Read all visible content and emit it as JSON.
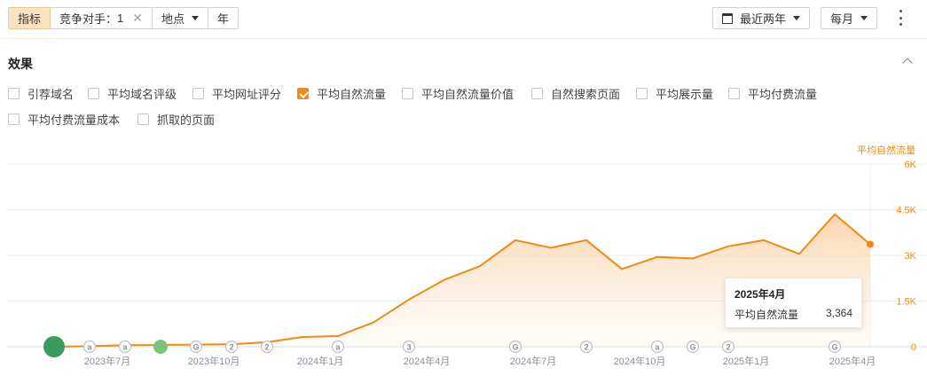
{
  "toolbar": {
    "metric_tab": "指标",
    "competitor_label": "竞争对手：",
    "competitor_count": "1",
    "location_label": "地点",
    "year_label": "年",
    "date_range_label": "最近两年",
    "granularity_label": "每月"
  },
  "section": {
    "title": "效果"
  },
  "metrics": [
    {
      "label": "引荐域名",
      "checked": false
    },
    {
      "label": "平均域名评级",
      "checked": false
    },
    {
      "label": "平均网址评分",
      "checked": false
    },
    {
      "label": "平均自然流量",
      "checked": true
    },
    {
      "label": "平均自然流量价值",
      "checked": false
    },
    {
      "label": "自然搜索页面",
      "checked": false
    },
    {
      "label": "平均展示量",
      "checked": false
    },
    {
      "label": "平均付费流量",
      "checked": false
    },
    {
      "label": "平均付费流量成本",
      "checked": false
    },
    {
      "label": "抓取的页面",
      "checked": false
    }
  ],
  "tooltip": {
    "title": "2025年4月",
    "series_label": "平均自然流量",
    "value": "3,364"
  },
  "chart_data": {
    "type": "area",
    "ylabel": "平均自然流量",
    "ylim": [
      0,
      6000
    ],
    "y_ticks": [
      "0",
      "1.5K",
      "3K",
      "4.5K",
      "6K"
    ],
    "y_tick_values": [
      0,
      1500,
      3000,
      4500,
      6000
    ],
    "x_ticks": [
      "2023年7月",
      "2023年10月",
      "2024年1月",
      "2024年4月",
      "2024年7月",
      "2024年10月",
      "2025年1月",
      "2025年4月"
    ],
    "x_tick_index": [
      2,
      5,
      8,
      11,
      14,
      17,
      20,
      23
    ],
    "x": [
      "2023年5月",
      "2023年6月",
      "2023年7月",
      "2023年8月",
      "2023年9月",
      "2023年10月",
      "2023年11月",
      "2023年12月",
      "2024年1月",
      "2024年2月",
      "2024年3月",
      "2024年4月",
      "2024年5月",
      "2024年6月",
      "2024年7月",
      "2024年8月",
      "2024年9月",
      "2024年10月",
      "2024年11月",
      "2024年12月",
      "2025年1月",
      "2025年2月",
      "2025年3月",
      "2025年4月"
    ],
    "series": [
      {
        "name": "平均自然流量",
        "color": "#f08a12",
        "values": [
          0,
          20,
          50,
          60,
          70,
          80,
          150,
          320,
          350,
          800,
          1550,
          2200,
          2650,
          3500,
          3250,
          3500,
          2550,
          2950,
          2900,
          3300,
          3500,
          3050,
          4350,
          3364
        ]
      }
    ],
    "annotations": [
      {
        "index": 0,
        "label": "",
        "kind": "green-large"
      },
      {
        "index": 1,
        "label": "a",
        "kind": "marker"
      },
      {
        "index": 3,
        "label": "a",
        "kind": "marker"
      },
      {
        "index": 4,
        "label": "",
        "kind": "green-small"
      },
      {
        "index": 5,
        "label": "G",
        "kind": "marker"
      },
      {
        "index": 6,
        "label": "2",
        "kind": "marker"
      },
      {
        "index": 7,
        "label": "2",
        "kind": "marker"
      },
      {
        "index": 9,
        "label": "a",
        "kind": "marker"
      },
      {
        "index": 12,
        "label": "3",
        "kind": "marker"
      },
      {
        "index": 15,
        "label": "G",
        "kind": "marker"
      },
      {
        "index": 18,
        "label": "2",
        "kind": "marker"
      },
      {
        "index": 21,
        "label": "a",
        "kind": "marker"
      },
      {
        "index": 22,
        "label": "G",
        "kind": "marker"
      },
      {
        "index": 23,
        "label": "2",
        "kind": "marker"
      },
      {
        "index": 25,
        "label": "G",
        "kind": "marker"
      }
    ],
    "grid": true,
    "accent": "#f08a12"
  }
}
